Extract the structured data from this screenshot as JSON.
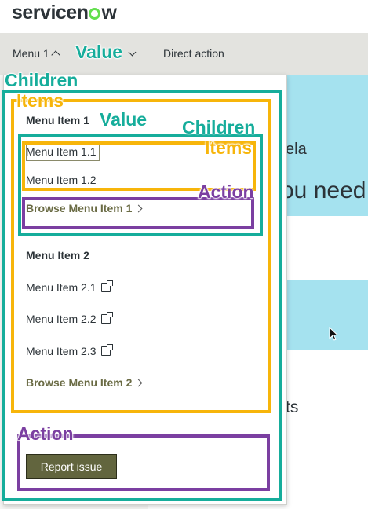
{
  "header": {
    "logo_text": "servicenow"
  },
  "nav": {
    "menu1_label": "Menu 1",
    "direct_action_label": "Direct action"
  },
  "background": {
    "text_ela": "ela",
    "text_need": "ou need",
    "text_ts": "ts"
  },
  "dropdown": {
    "item1": {
      "title": "Menu Item 1",
      "children": [
        "Menu Item 1.1",
        "Menu Item 1.2"
      ],
      "browse_label": "Browse Menu Item 1"
    },
    "item2": {
      "title": "Menu Item 2",
      "children": [
        "Menu Item 2.1",
        "Menu Item 2.2",
        "Menu Item 2.3"
      ],
      "browse_label": "Browse Menu Item 2"
    },
    "report_issue_label": "Report issue"
  },
  "annotations": {
    "value_nav": "Value",
    "children_outer": "Children",
    "items_outer": "Items",
    "value_item1": "Value",
    "children_inner": "Children",
    "items_inner": "Items",
    "action_inner": "Action",
    "action_bottom": "Action"
  },
  "colors": {
    "teal_annotation": "#16ad9b",
    "yellow_annotation": "#f7b50a",
    "purple_annotation": "#7b3fa1",
    "report_button": "#62653e",
    "hero_background": "#a5e2ef"
  },
  "icons": [
    "chevron-up-icon",
    "chevron-down-icon",
    "chevron-right-icon",
    "external-link-icon",
    "mouse-cursor-icon"
  ]
}
